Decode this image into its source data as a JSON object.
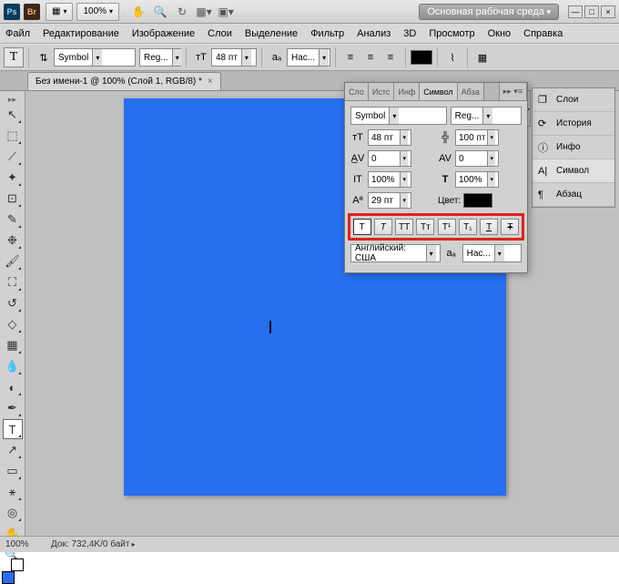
{
  "titlebar": {
    "app_abbr": "Ps",
    "bridge_abbr": "Br",
    "zoom": "100%",
    "workspace": "Основная рабочая среда"
  },
  "menu": {
    "file": "Файл",
    "edit": "Редактирование",
    "image": "Изображение",
    "layer": "Слои",
    "select": "Выделение",
    "filter": "Фильтр",
    "analysis": "Анализ",
    "threeD": "3D",
    "view": "Просмотр",
    "window": "Окно",
    "help": "Справка"
  },
  "optbar": {
    "tool_glyph": "T",
    "font_family": "Symbol",
    "font_style": "Reg...",
    "size_icon": "тТ",
    "size": "48 пт",
    "aa_label": "aₐ",
    "aa": "Нас...",
    "align_left": "≡",
    "align_center": "≡",
    "align_right": "≡",
    "color_swatch": "#000000",
    "warp": "⌇",
    "panel_toggle": "▦"
  },
  "document": {
    "tab_title": "Без имени-1 @ 100% (Слой 1, RGB/8) *",
    "canvas_color": "#266fef"
  },
  "tools": [
    {
      "name": "move",
      "glyph": "↖"
    },
    {
      "name": "marquee",
      "glyph": "⬚"
    },
    {
      "name": "lasso",
      "glyph": "⟋"
    },
    {
      "name": "wand",
      "glyph": "✦"
    },
    {
      "name": "crop",
      "glyph": "⊡"
    },
    {
      "name": "eyedropper",
      "glyph": "✎"
    },
    {
      "name": "heal",
      "glyph": "❉"
    },
    {
      "name": "brush",
      "glyph": "🖌"
    },
    {
      "name": "stamp",
      "glyph": "⛶"
    },
    {
      "name": "history-brush",
      "glyph": "↺"
    },
    {
      "name": "eraser",
      "glyph": "◇"
    },
    {
      "name": "gradient",
      "glyph": "▦"
    },
    {
      "name": "blur",
      "glyph": "💧"
    },
    {
      "name": "dodge",
      "glyph": "◐"
    },
    {
      "name": "pen",
      "glyph": "✒"
    },
    {
      "name": "type",
      "glyph": "T",
      "active": true
    },
    {
      "name": "path-sel",
      "glyph": "↗"
    },
    {
      "name": "shape",
      "glyph": "▭"
    },
    {
      "name": "3d",
      "glyph": "⚹"
    },
    {
      "name": "camera",
      "glyph": "◎"
    },
    {
      "name": "hand",
      "glyph": "✋"
    },
    {
      "name": "zoom",
      "glyph": "🔍"
    }
  ],
  "char_panel": {
    "tabs": {
      "t1": "Сло",
      "t2": "Истс",
      "t3": "Инф",
      "t4": "Символ",
      "t5": "Абза"
    },
    "font_family": "Symbol",
    "font_style": "Reg...",
    "size": "48 пт",
    "leading": "100 пт",
    "kerning": "0",
    "tracking": "0",
    "vscale": "100%",
    "hscale": "100%",
    "baseline": "29 пт",
    "color_label": "Цвет:",
    "styles": [
      "T",
      "T",
      "TT",
      "Tт",
      "T¹",
      "T₁",
      "T",
      "Ŧ"
    ],
    "language": "Английский: США",
    "aa_label": "aₐ",
    "aa": "Нас..."
  },
  "right_panels": [
    {
      "icon": "❐",
      "label": "Слои"
    },
    {
      "icon": "⟳",
      "label": "История"
    },
    {
      "icon": "ⓘ",
      "label": "Инфо"
    },
    {
      "icon": "A|",
      "label": "Символ",
      "active": true
    },
    {
      "icon": "¶",
      "label": "Абзац"
    }
  ],
  "status": {
    "zoom": "100%",
    "info": "Док: 732,4K/0 байт"
  }
}
